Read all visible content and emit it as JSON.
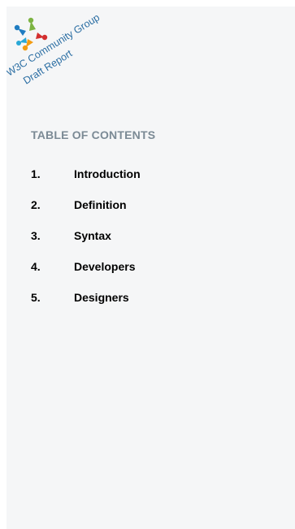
{
  "logo": {
    "line1": "W3C Community Group",
    "line2": "Draft Report",
    "text_color": "#2b6ea3",
    "colors": {
      "blue": "#1f7cc1",
      "green": "#7cb342",
      "red": "#d32f2f",
      "orange": "#f39c12",
      "cyan": "#29a8d6"
    }
  },
  "toc": {
    "heading": "TABLE OF CONTENTS",
    "items": [
      {
        "num": "1.",
        "label": "Introduction"
      },
      {
        "num": "2.",
        "label": "Definition"
      },
      {
        "num": "3.",
        "label": "Syntax"
      },
      {
        "num": "4.",
        "label": "Developers"
      },
      {
        "num": "5.",
        "label": "Designers"
      }
    ]
  }
}
